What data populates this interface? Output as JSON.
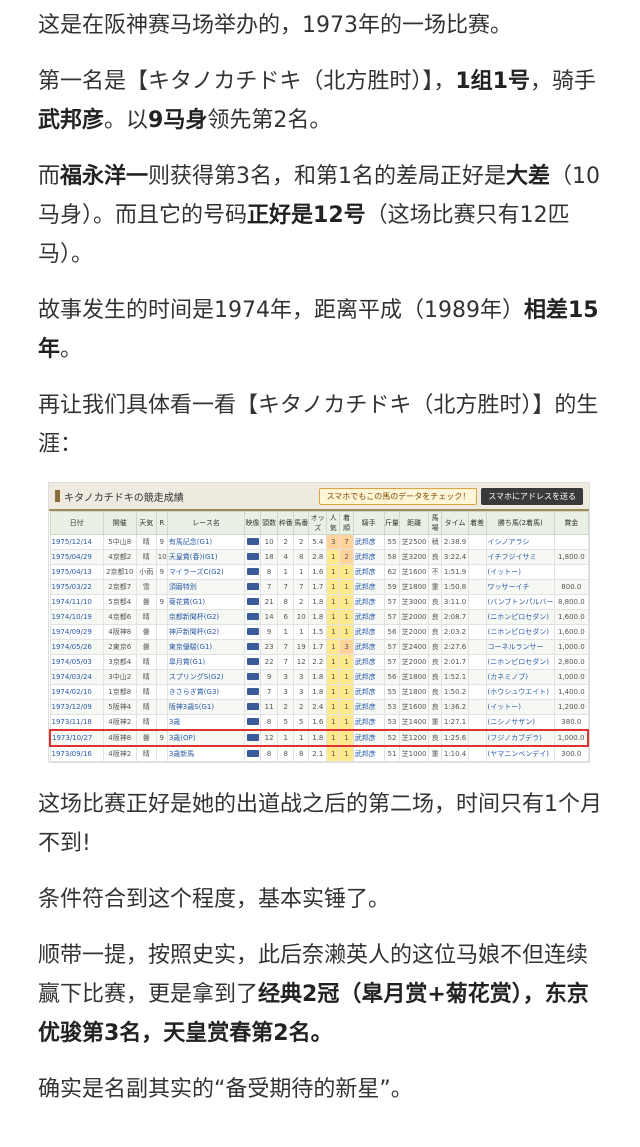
{
  "paragraphs": {
    "p1": "这是在阪神赛马场举办的，1973年的一场比赛。",
    "p2": [
      "第一名是【キタノカチドキ（北方胜时）】，",
      "1组1号",
      "，骑手",
      "武邦彦",
      "。以",
      "9马身",
      "领先第2名。"
    ],
    "p3": [
      "而",
      "福永洋一",
      "则获得第3名，和第1名的差局正好是",
      "大差",
      "（10马身）。而且它的号码",
      "正好是12号",
      "（这场比赛只有12匹马）。"
    ],
    "p4": [
      "故事发生的时间是1974年，距离平成（1989年）",
      "相差15年",
      "。"
    ],
    "p5": "再让我们具体看一看【キタノカチドキ（北方胜时）】的生涯：",
    "p6": "这场比赛正好是她的出道战之后的第二场，时间只有1个月不到!",
    "p7": "条件符合到这个程度，基本实锤了。",
    "p8": [
      "顺带一提，按照史实，此后奈濑英人的这位马娘不但连续赢下比赛，更是拿到了",
      "经典2冠（皐月赏+菊花赏），东京优骏第3名，天皇赏春第2名。"
    ],
    "p9": "确实是名副其实的“备受期待的新星”。"
  },
  "figure": {
    "title": "キタノカチドキの競走成績",
    "promo": "スマホでもこの馬のデータをチェック！",
    "promo_button": "スマホにアドレスを送る",
    "headers": [
      "日付",
      "開催",
      "天気",
      "R",
      "レース名",
      "映像",
      "頭数",
      "枠番",
      "馬番",
      "オッズ",
      "人気",
      "着順",
      "騎手",
      "斤量",
      "距離",
      "馬場",
      "タイム",
      "着差",
      "勝ち馬(2着馬)",
      "賞金"
    ],
    "rows": [
      [
        "1975/12/14",
        "5中山8",
        "晴",
        "9",
        "有馬記念(G1)",
        "",
        "10",
        "2",
        "2",
        "5.4",
        "3",
        "7",
        "武邦彦",
        "55",
        "芝2500",
        "稍",
        "2:38.9",
        "",
        "イシノアラシ",
        ""
      ],
      [
        "1975/04/29",
        "4京都2",
        "晴",
        "10",
        "天皇賞(春)(G1)",
        "",
        "18",
        "4",
        "8",
        "2.8",
        "1",
        "2",
        "武邦彦",
        "58",
        "芝3200",
        "良",
        "3:22.4",
        "",
        "イチフジイサミ",
        "1,800.0"
      ],
      [
        "1975/04/13",
        "2京都10",
        "小雨",
        "9",
        "マイラーズC(G2)",
        "",
        "8",
        "1",
        "1",
        "1.6",
        "1",
        "1",
        "武邦彦",
        "62",
        "芝1600",
        "不",
        "1:51.9",
        "",
        "(イットー)",
        ""
      ],
      [
        "1975/03/22",
        "2京都7",
        "雪",
        "",
        "須磨特別",
        "",
        "7",
        "7",
        "7",
        "1.7",
        "1",
        "1",
        "武邦彦",
        "59",
        "芝1800",
        "重",
        "1:50.8",
        "",
        "ワッサーイチ",
        "800.0"
      ],
      [
        "1974/11/10",
        "5京都4",
        "曇",
        "9",
        "菊花賞(G1)",
        "",
        "21",
        "8",
        "2",
        "1.8",
        "1",
        "1",
        "武邦彦",
        "57",
        "芝3000",
        "良",
        "3:11.0",
        "",
        "(バンブトンパルバー)",
        "8,800.0"
      ],
      [
        "1974/10/19",
        "4京都6",
        "晴",
        "",
        "京都新聞杯(G2)",
        "",
        "14",
        "6",
        "10",
        "1.8",
        "1",
        "1",
        "武邦彦",
        "57",
        "芝2000",
        "良",
        "2:08.7",
        "",
        "(ニホンピロセダン)",
        "1,600.0"
      ],
      [
        "1974/09/29",
        "4阪神8",
        "曇",
        "",
        "神戸新聞杯(G2)",
        "",
        "9",
        "1",
        "1",
        "1.5",
        "1",
        "1",
        "武邦彦",
        "56",
        "芝2000",
        "良",
        "2:03.2",
        "",
        "(ニホンピロセダン)",
        "1,600.0"
      ],
      [
        "1974/05/26",
        "2東京6",
        "曇",
        "",
        "東京優駿(G1)",
        "",
        "23",
        "7",
        "19",
        "1.7",
        "1",
        "3",
        "武邦彦",
        "57",
        "芝2400",
        "良",
        "2:27.6",
        "",
        "コーネルランサー",
        "1,000.0"
      ],
      [
        "1974/05/03",
        "3京都4",
        "晴",
        "",
        "皐月賞(G1)",
        "",
        "22",
        "7",
        "12",
        "2.2",
        "1",
        "1",
        "武邦彦",
        "57",
        "芝2000",
        "良",
        "2:01.7",
        "",
        "(ニホンピロセダン)",
        "2,800.0"
      ],
      [
        "1974/03/24",
        "3中山2",
        "晴",
        "",
        "スプリングS(G2)",
        "",
        "9",
        "3",
        "3",
        "1.8",
        "1",
        "1",
        "武邦彦",
        "56",
        "芝1800",
        "良",
        "1:52.1",
        "",
        "(カネミノブ)",
        "1,000.0"
      ],
      [
        "1974/02/10",
        "1京都8",
        "晴",
        "",
        "きさらぎ賞(G3)",
        "",
        "7",
        "3",
        "3",
        "1.8",
        "1",
        "1",
        "武邦彦",
        "55",
        "芝1800",
        "良",
        "1:50.2",
        "",
        "(ホウシュウエイト)",
        "1,400.0"
      ],
      [
        "1973/12/09",
        "5阪神4",
        "晴",
        "",
        "阪神3歳S(G1)",
        "",
        "11",
        "2",
        "2",
        "2.4",
        "1",
        "1",
        "武邦彦",
        "53",
        "芝1600",
        "良",
        "1:36.2",
        "",
        "(イットー)",
        "1,200.0"
      ],
      [
        "1973/11/18",
        "4阪神2",
        "晴",
        "",
        "3歳",
        "",
        "8",
        "5",
        "5",
        "1.6",
        "1",
        "1",
        "武邦彦",
        "53",
        "芝1400",
        "重",
        "1:27.1",
        "",
        "(ニシノサザン)",
        "380.0"
      ],
      [
        "1973/10/27",
        "4阪神8",
        "曇",
        "9",
        "3歳(OP)",
        "",
        "12",
        "1",
        "1",
        "1.8",
        "1",
        "1",
        "武邦彦",
        "52",
        "芝1200",
        "良",
        "1:25.6",
        "",
        "(フジノカブデラ)",
        "1,000.0"
      ],
      [
        "1973/09/16",
        "4阪神2",
        "晴",
        "",
        "3歳新馬",
        "",
        "8",
        "8",
        "8",
        "2.1",
        "1",
        "1",
        "武邦彦",
        "51",
        "芝1000",
        "重",
        "1:10.4",
        "",
        "(ヤマニンベンデイ)",
        "300.0"
      ]
    ],
    "selected_row": 13
  }
}
